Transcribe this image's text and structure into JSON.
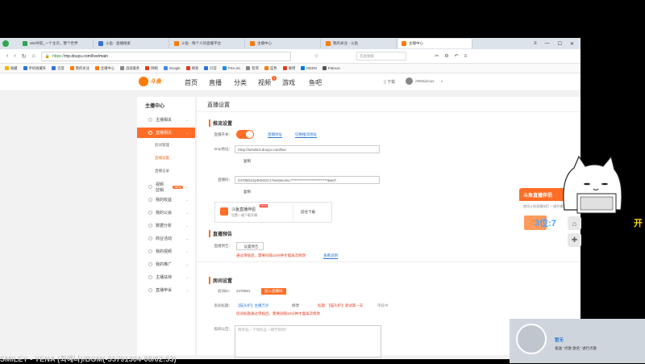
{
  "browser": {
    "tabs": [
      {
        "label": "360导航_一个主页，整个世界",
        "color": "#2ea44f",
        "active": false
      },
      {
        "label": "斗鱼 - 直播搜索",
        "color": "#3a6fd8",
        "active": false
      },
      {
        "label": "斗鱼 - 每个人的直播平台",
        "color": "#ff7a00",
        "active": false
      },
      {
        "label": "主播中心",
        "color": "#ff7a00",
        "active": false
      },
      {
        "label": "我的关注 - 斗鱼",
        "color": "#ff7a00",
        "active": false
      },
      {
        "label": "主播中心",
        "color": "#ff7a00",
        "active": true
      }
    ],
    "window_controls": [
      "≡",
      "—",
      "☐",
      "✕"
    ],
    "url_scheme": "https://",
    "url_rest": "mp.douyu.com/live/main",
    "search_placeholder": "在此搜索",
    "bookmarks": [
      "收藏",
      "手机收藏夹",
      "百度",
      "我的关注",
      "主播中心",
      "战就服务",
      "网络",
      "Google",
      "网易",
      "问答",
      "PSA.mc",
      "智库",
      "蓝色",
      "微博",
      "MSDN",
      "Patreon"
    ]
  },
  "site": {
    "logo_text": "斗鱼",
    "nav": [
      "首页",
      "直播",
      "分类",
      "视频",
      "游戏",
      "鱼吧"
    ],
    "nav_badge": "1",
    "download_label": "下载",
    "user_name": "ARMukrous"
  },
  "sidebar": {
    "title": "主播中心",
    "items": [
      {
        "label": "主播相关",
        "active": false
      },
      {
        "label": "直播相关",
        "active": true
      },
      {
        "label": "视频剪辑",
        "active": false,
        "badge": "NEW"
      },
      {
        "label": "我的收益",
        "active": false
      },
      {
        "label": "我的公会",
        "active": false
      },
      {
        "label": "数据分析",
        "active": false
      },
      {
        "label": "商业活动",
        "active": false
      },
      {
        "label": "我的视频",
        "active": false
      },
      {
        "label": "我的推广",
        "active": false
      },
      {
        "label": "主播扶持",
        "active": false
      },
      {
        "label": "直播申诉",
        "active": false
      }
    ],
    "subitems": [
      "房间管理",
      "直播设置",
      "直播记录"
    ],
    "current_sub": "直播设置"
  },
  "content": {
    "page_title": "直播设置",
    "stream_section": "推流设置",
    "switch_label": "直播开关：",
    "link_a": "直播地址",
    "link_b": "切换推流地址",
    "rtmp_label": "rtmp地址：",
    "rtmp_value": "rtmp://sendtc3.douyu.com/live",
    "copy_label": "复制",
    "code_label": "直播码：",
    "code_value": "2470501rQ4K6OzCz?wsSecret=**************************&wsT",
    "copy_label2": "复制",
    "tool_name": "斗鱼直播伴侣",
    "tool_badge": "NEW",
    "tool_desc": "设置一键下载开播",
    "tool_btn": "前往下载",
    "notice_section": "直播预告",
    "notice_label": "直播预告：",
    "notice_btn": "设置预告",
    "notice_tip": "通过审核后，需要间隔10分钟才能再次修改",
    "notice_link": "查看说明",
    "room_section": "房间设置",
    "room_id_label": "房间ID：",
    "room_id": "2470501",
    "room_btn": "进入直播间",
    "room_title_label": "房间标题：",
    "room_title_value": "【猫头护】主播万岁",
    "edit_label": "修改",
    "title_tip_a": "标题：【猫头护】测试第一天",
    "title_tip_b": "审核中",
    "title_tip_c": "房间标题通过审核后，需要间隔10分钟才能再次修改",
    "announce_label": "房间公告：",
    "announce_placeholder": "简单说一下你的这一期节目吧！"
  },
  "promo": {
    "title": "斗鱼直播伴侣",
    "subtitle": "使用斗鱼直播伴侣 一键开播更方便"
  },
  "overlay": {
    "score_text": "3位:7",
    "side_text": "开",
    "ticker": "SMILEY - YENA (최예나)/BGM(-35791304-08/02:53)",
    "video_title": "暂无",
    "video_line": "发送 \"点歌 歌名\" 进行点歌"
  }
}
